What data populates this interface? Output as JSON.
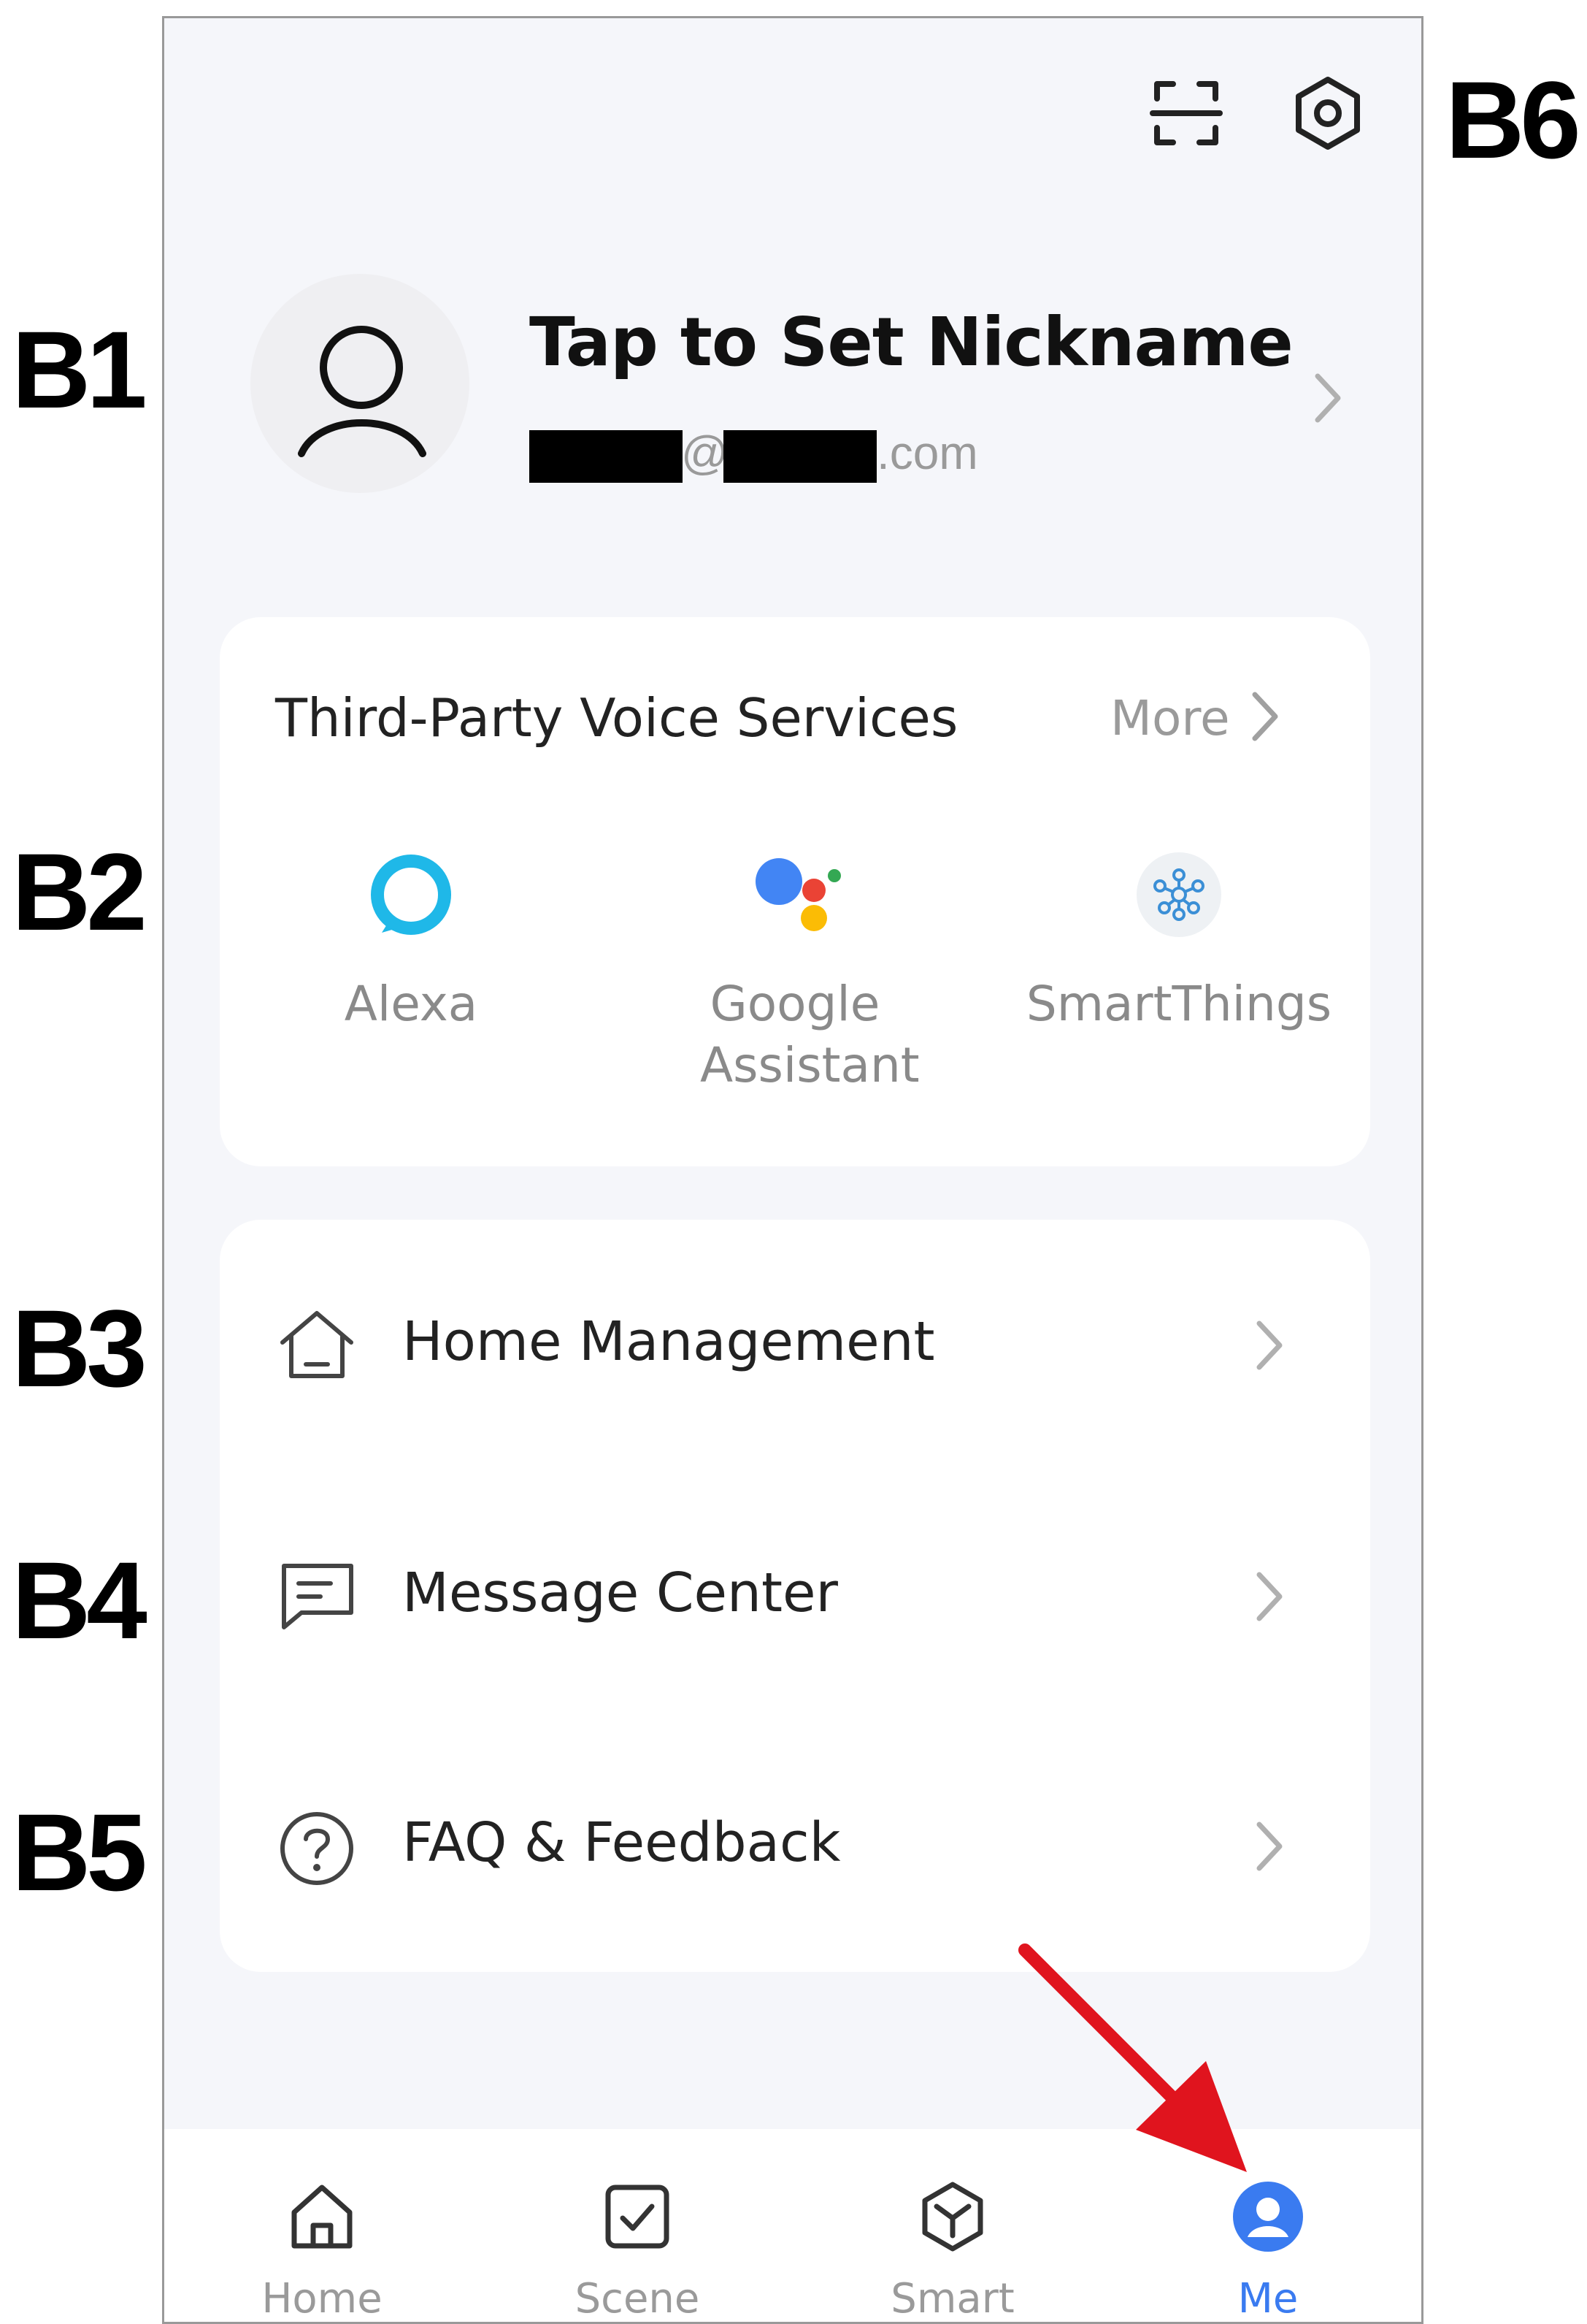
{
  "callouts": {
    "b1": "B1",
    "b2": "B2",
    "b3": "B3",
    "b4": "B4",
    "b5": "B5",
    "b6": "B6"
  },
  "header": {
    "scan_icon": "scan-icon",
    "settings_icon": "settings-hex-icon"
  },
  "profile": {
    "nickname": "Tap to Set Nickname",
    "email_at": "@",
    "email_domain": ".com"
  },
  "voice_services": {
    "title": "Third-Party Voice Services",
    "more_label": "More",
    "items": [
      {
        "label": "Alexa",
        "icon": "alexa-icon"
      },
      {
        "label": "Google Assistant",
        "icon": "google-assistant-icon"
      },
      {
        "label": "SmartThings",
        "icon": "smartthings-icon"
      }
    ]
  },
  "menu": {
    "items": [
      {
        "label": "Home Management",
        "icon": "house-icon"
      },
      {
        "label": "Message Center",
        "icon": "message-icon"
      },
      {
        "label": "FAQ & Feedback",
        "icon": "question-icon"
      }
    ]
  },
  "tabbar": {
    "tabs": [
      {
        "label": "Home",
        "active": false
      },
      {
        "label": "Scene",
        "active": false
      },
      {
        "label": "Smart",
        "active": false
      },
      {
        "label": "Me",
        "active": true
      }
    ]
  },
  "colors": {
    "accent": "#3a7bf0",
    "arrow": "#e0141e",
    "page_bg": "#f5f6fa"
  }
}
